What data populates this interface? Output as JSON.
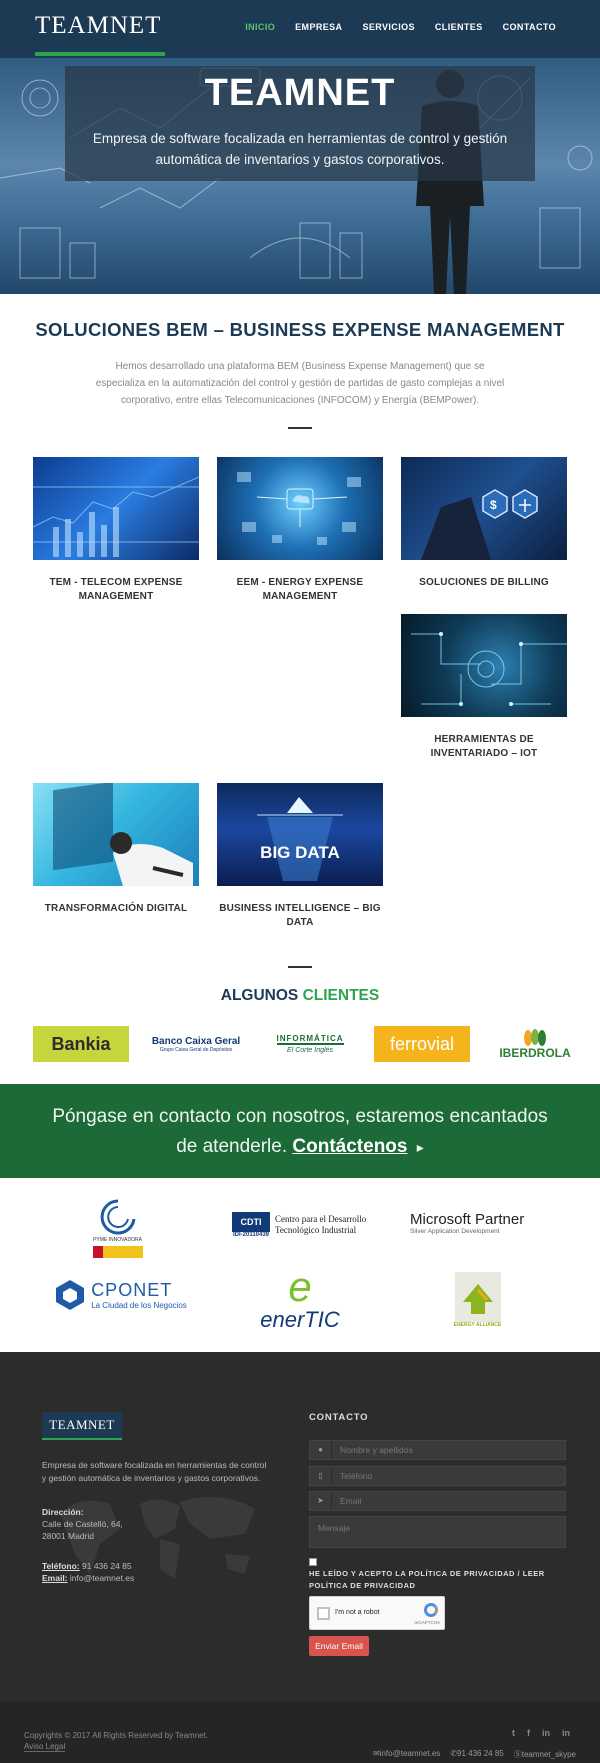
{
  "header": {
    "logo": "TEAMNET",
    "nav": [
      "INICIO",
      "EMPRESA",
      "SERVICIOS",
      "CLIENTES",
      "CONTACTO"
    ]
  },
  "hero": {
    "title": "TEAMNET",
    "subtitle": "Empresa de software focalizada en herramientas de control y gestión automática de inventarios y gastos corporativos."
  },
  "solutions": {
    "title": "SOLUCIONES BEM – BUSINESS EXPENSE MANAGEMENT",
    "description": "Hemos desarrollado una plataforma BEM (Business Expense Management) que se especializa en la automatización del control y gestión de partidas de gasto complejas a nivel corporativo, entre ellas Telecomunicaciones (INFOCOM) y Energía (BEMPower).",
    "cards": [
      "TEM - TELECOM EXPENSE MANAGEMENT",
      "EEM - ENERGY EXPENSE MANAGEMENT",
      "SOLUCIONES DE BILLING",
      "HERRAMIENTAS DE INVENTARIADO – IOT",
      "TRANSFORMACIÓN DIGITAL",
      "BUSINESS INTELLIGENCE – BIG DATA"
    ],
    "big_data_text": "BIG DATA"
  },
  "clients": {
    "title_part1": "ALGUNOS",
    "title_part2": "CLIENTES",
    "logos": {
      "bankia": "Bankia",
      "caixa": "Banco Caixa Geral",
      "caixa_sub": "Grupo Caixa Geral de Depósitos",
      "informatica": "INFORMÁTICA",
      "informatica_sub": "El Corte Inglés",
      "ferrovial": "ferrovial",
      "iberdrola": "IBERDROLA"
    }
  },
  "cta": {
    "text": "Póngase en contacto con nosotros, estaremos encantados de atenderle.",
    "link": "Contáctenos"
  },
  "partners": {
    "pyme": "PYME INNOVADORA",
    "cdti": "CDTI",
    "cdti_code": "IDI-20110439",
    "cdti_text": "Centro para el Desarrollo Tecnológico Industrial",
    "ms_title": "Microsoft Partner",
    "ms_sub": "Silver Application Development",
    "cponet": "CPONET",
    "cponet_sub": "La Ciudad de los Negocios",
    "enertic": "enerTIC",
    "eaa": "ENERGY ALLIANCE"
  },
  "footer": {
    "logo": "TEAMNET",
    "description": "Empresa de software focalizada en herramientas de control y gestión automática de inventarios y gastos corporativos.",
    "address_label": "Dirección:",
    "address": "Calle de Castelló, 64, 28001 Madrid",
    "phone_label": "Teléfono:",
    "phone": "91 436 24 85",
    "email_label": "Email:",
    "email": "info@teamnet.es",
    "contact_title": "CONTACTO",
    "name_placeholder": "Nombre y apellidos",
    "phone_placeholder": "Teléfono",
    "email_placeholder": "Email",
    "message_placeholder": "Mensaje",
    "privacy": "HE LEÍDO Y ACEPTO LA POLÍTICA DE PRIVACIDAD / LEER POLÍTICA DE PRIVACIDAD",
    "captcha_label": "I'm not a robot",
    "captcha_brand": "reCAPTCHA",
    "send_label": "Enviar Email"
  },
  "bottom": {
    "copyright": "Copyrights © 2017 All Rights Reserved by Teamnet.",
    "aviso": "Aviso Legal",
    "contact_email": "info@teamnet.es",
    "contact_phone": "91 436 24 85",
    "contact_skype": "teamnet_skype"
  }
}
